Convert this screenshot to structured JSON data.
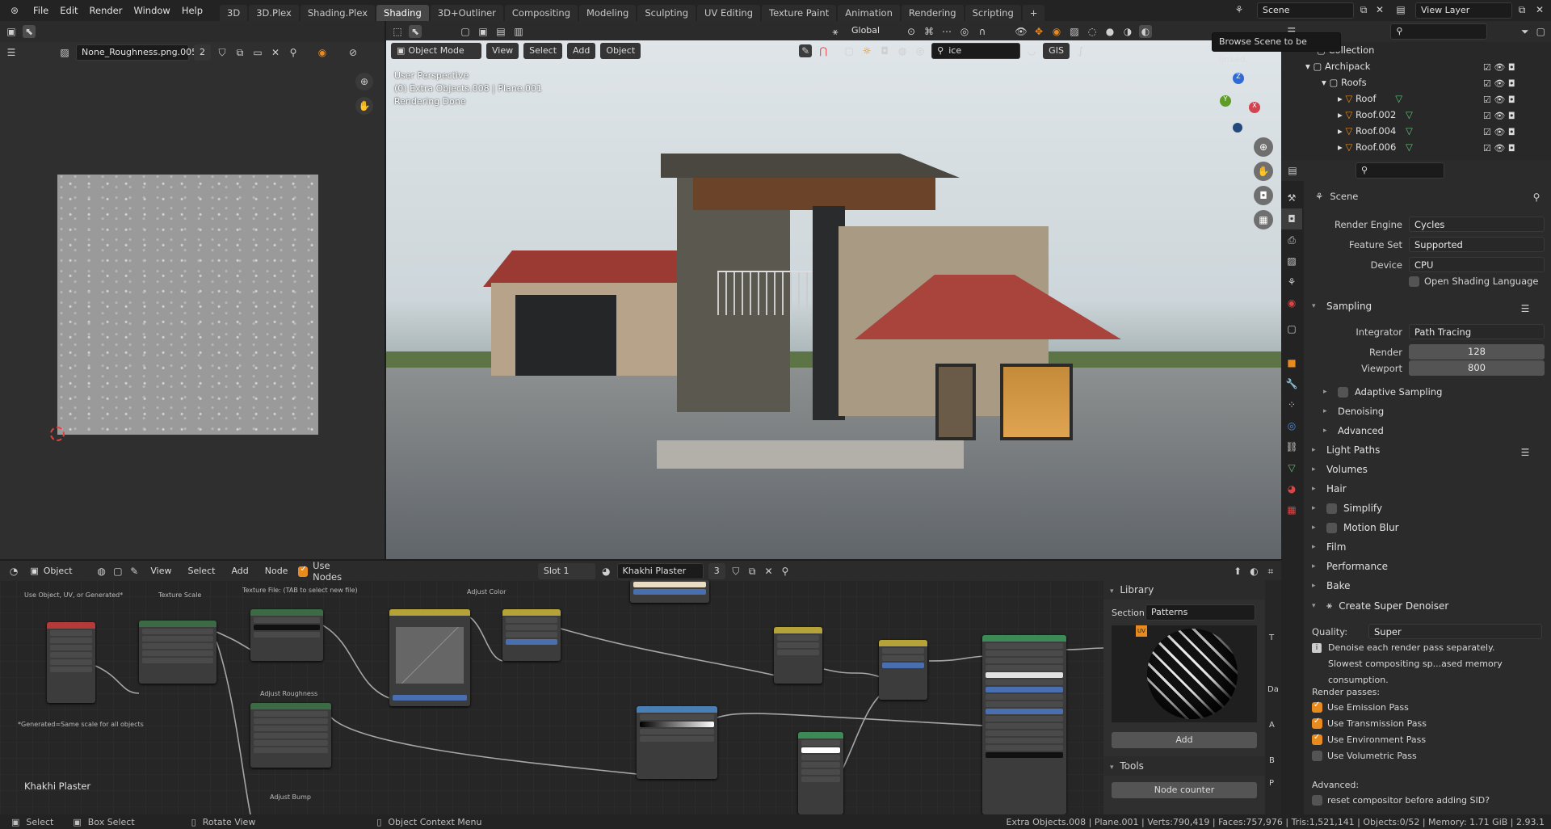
{
  "top_menu": [
    "File",
    "Edit",
    "Render",
    "Window",
    "Help"
  ],
  "workspace_tabs": [
    {
      "label": "3D",
      "active": false
    },
    {
      "label": "3D.Plex",
      "active": false
    },
    {
      "label": "Shading.Plex",
      "active": false
    },
    {
      "label": "Shading",
      "active": true
    },
    {
      "label": "3D+Outliner",
      "active": false
    },
    {
      "label": "Compositing",
      "active": false
    },
    {
      "label": "Modeling",
      "active": false
    },
    {
      "label": "Sculpting",
      "active": false
    },
    {
      "label": "UV Editing",
      "active": false
    },
    {
      "label": "Texture Paint",
      "active": false
    },
    {
      "label": "Animation",
      "active": false
    },
    {
      "label": "Rendering",
      "active": false
    },
    {
      "label": "Scripting",
      "active": false
    }
  ],
  "scene_field": "Scene",
  "view_layer_field": "View Layer",
  "tooltip": "Browse Scene to be linked.",
  "image_editor": {
    "image_name": "None_Roughness.png.005",
    "users": "2"
  },
  "viewport": {
    "mode": "Object Mode",
    "menus": [
      "View",
      "Select",
      "Add",
      "Object"
    ],
    "orientation": "Global",
    "search": "ice",
    "gis": "GIS",
    "overlay_lines": [
      "User Perspective",
      "(0) Extra Objects.008 | Plane.001",
      "Rendering Done"
    ]
  },
  "outliner": {
    "rows": [
      {
        "label": "Collection",
        "indent": 0
      },
      {
        "label": "Archipack",
        "indent": 1
      },
      {
        "label": "Roofs",
        "indent": 2
      },
      {
        "label": "Roof",
        "indent": 3
      },
      {
        "label": "Roof.002",
        "indent": 3
      },
      {
        "label": "Roof.004",
        "indent": 3
      },
      {
        "label": "Roof.006",
        "indent": 3
      }
    ]
  },
  "properties": {
    "context": "Scene",
    "render_engine_label": "Render Engine",
    "render_engine": "Cycles",
    "feature_set_label": "Feature Set",
    "feature_set": "Supported",
    "device_label": "Device",
    "device": "CPU",
    "osl": "Open Shading Language",
    "sampling": "Sampling",
    "integrator_label": "Integrator",
    "integrator": "Path Tracing",
    "render_label": "Render",
    "render_samples": "128",
    "viewport_label": "Viewport",
    "viewport_samples": "800",
    "sub_sections": [
      "Adaptive Sampling",
      "Denoising",
      "Advanced"
    ],
    "sections": [
      "Light Paths",
      "Volumes",
      "Hair",
      "Simplify",
      "Motion Blur",
      "Film",
      "Performance",
      "Bake",
      "Create Super Denoiser"
    ],
    "quality_label": "Quality:",
    "quality": "Super",
    "info_line1": "Denoise each render pass separately.",
    "info_line2": "Slowest compositing sp...ased memory consumption.",
    "render_passes_label": "Render passes:",
    "passes": [
      {
        "label": "Use Emission Pass",
        "on": true
      },
      {
        "label": "Use Transmission Pass",
        "on": true
      },
      {
        "label": "Use Environment Pass",
        "on": true
      },
      {
        "label": "Use Volumetric Pass",
        "on": false
      }
    ],
    "advanced_label": "Advanced:",
    "reset_label": "reset compositor before adding SID?"
  },
  "node_editor": {
    "object_mode": "Object",
    "menus": [
      "View",
      "Select",
      "Add",
      "Node"
    ],
    "use_nodes": "Use Nodes",
    "slot": "Slot 1",
    "material": "Khakhi Plaster",
    "material_users": "3",
    "material_label": "Khakhi Plaster",
    "frame_labels": [
      "Use Object, UV, or Generated*",
      "Texture Scale",
      "Texture File: (TAB to select new file)",
      "Adjust Color",
      "Adjust Roughness",
      "Adjust Bump",
      "*Generated=Same scale for all objects"
    ],
    "library": {
      "title": "Library",
      "section_label": "Section:",
      "section": "Patterns",
      "add_button": "Add",
      "tools_title": "Tools",
      "node_counter": "Node counter",
      "side_tabs": [
        "T",
        "Da",
        "A",
        "B",
        "P"
      ]
    }
  },
  "statusbar": {
    "select": "Select",
    "box_select": "Box Select",
    "rotate": "Rotate View",
    "context_menu": "Object Context Menu",
    "stats": "Extra Objects.008 | Plane.001 | Verts:790,419 | Faces:757,976 | Tris:1,521,141 | Objects:0/52 | Memory: 1.71 GiB | 2.93.1"
  }
}
